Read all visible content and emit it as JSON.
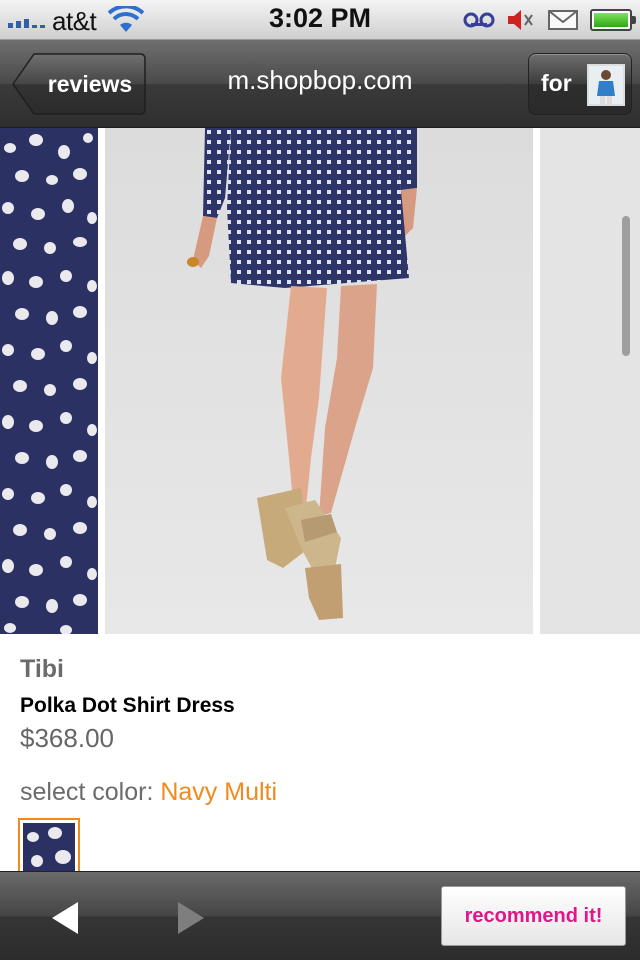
{
  "status_bar": {
    "carrier": "at&t",
    "time": "3:02 PM",
    "icons": [
      "signal-bars-icon",
      "wifi-icon",
      "voicemail-icon",
      "mute-speaker-icon",
      "mail-icon",
      "battery-icon"
    ]
  },
  "nav": {
    "back_label": "reviews",
    "title": "m.shopbop.com",
    "for_label": "for"
  },
  "product": {
    "brand": "Tibi",
    "name": "Polka Dot Shirt Dress",
    "price": "$368.00",
    "color_label": "select color:",
    "color_value": "Navy Multi"
  },
  "toolbar": {
    "recommend_label": "recommend it!"
  },
  "colors": {
    "accent_orange": "#f08a1c",
    "recommend_pink": "#e0168a",
    "navy": "#2b3162"
  }
}
